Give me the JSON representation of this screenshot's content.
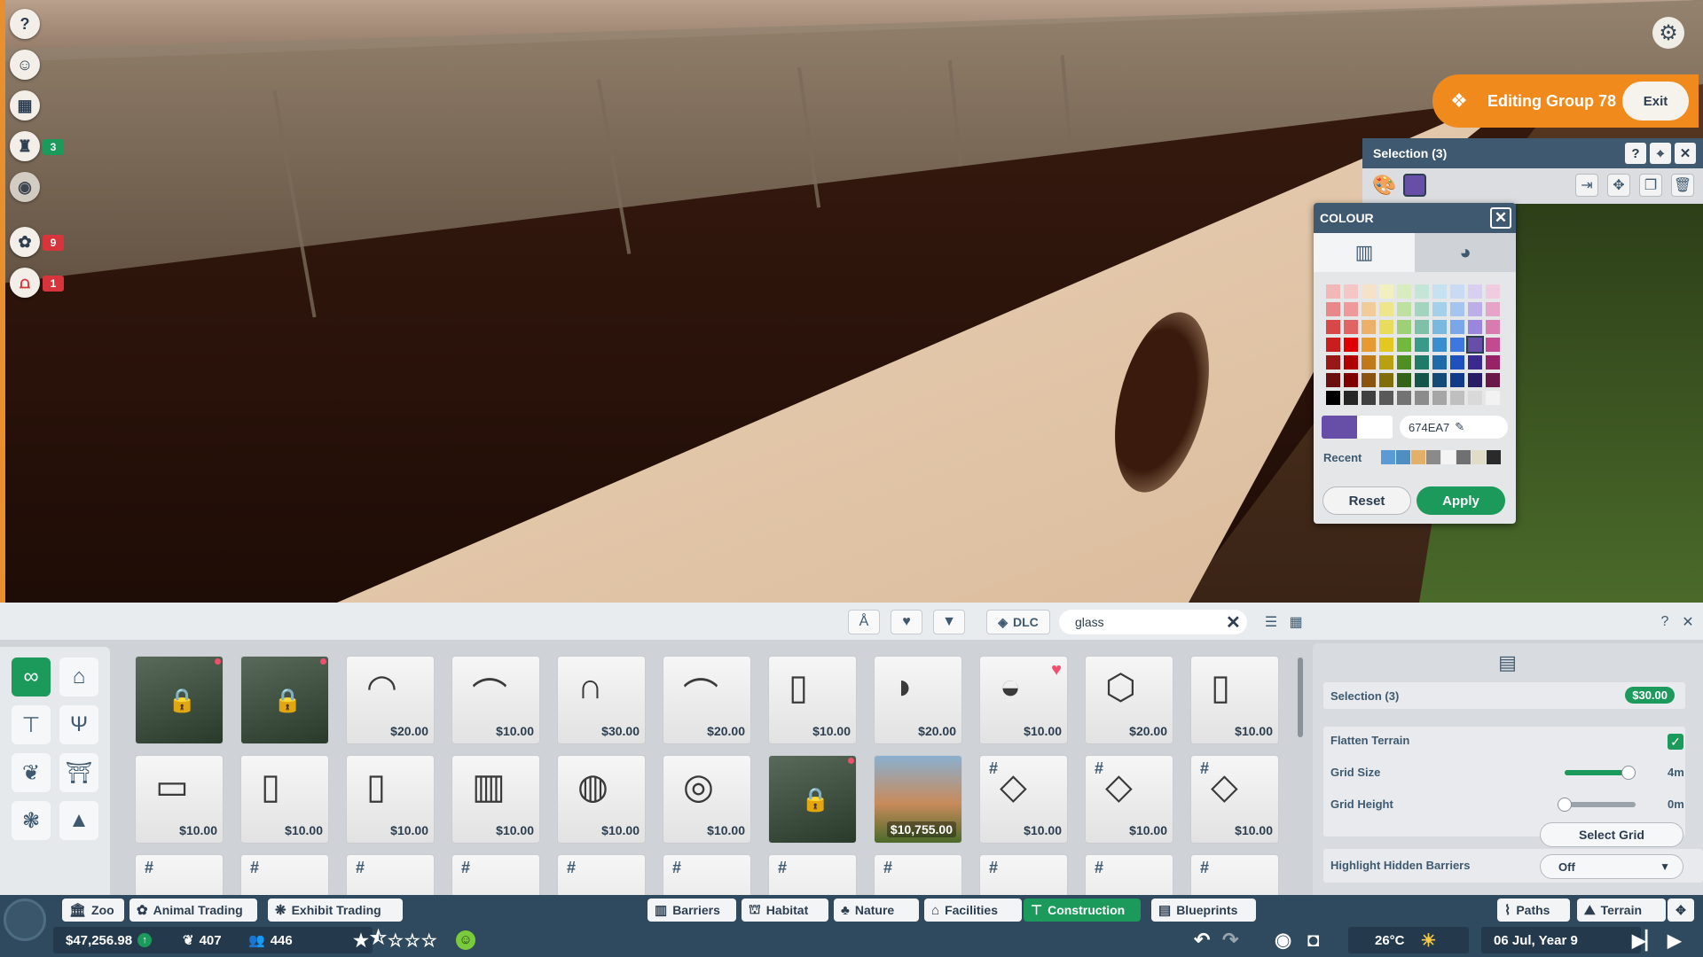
{
  "left_sidebar": {
    "items": [
      {
        "icon": "help-icon",
        "badge": ""
      },
      {
        "icon": "animal-face-icon",
        "badge": ""
      },
      {
        "icon": "calendar-icon",
        "badge": ""
      },
      {
        "icon": "trophy-icon",
        "badge": "3",
        "badge_color": "#1b9a5c"
      },
      {
        "icon": "eye-icon",
        "badge": ""
      },
      {
        "icon": "paw-icon",
        "badge": "9",
        "badge_color": "#d8343c"
      },
      {
        "icon": "habitat-gate-icon",
        "badge": "1",
        "badge_color": "#d8343c"
      }
    ]
  },
  "edit_mode": {
    "title": "Editing Group 78",
    "exit_label": "Exit"
  },
  "selection_panel": {
    "title": "Selection (3)"
  },
  "colour_panel": {
    "title": "COLOUR",
    "hex_value": "674EA7",
    "selected_color": "#674ea7",
    "recent_label": "Recent",
    "recent_colors": [
      "#5b9bd5",
      "#4f8ec0",
      "#e2b06a",
      "#8a8a8a",
      "#f4f4f4",
      "#707070",
      "#e0dcc8",
      "#2a2a2a"
    ],
    "reset_label": "Reset",
    "apply_label": "Apply",
    "palette": [
      [
        "#f2b8b8",
        "#f4c6c6",
        "#f6e2c8",
        "#f2efc0",
        "#d8ecc0",
        "#c4e6d8",
        "#c6e2f2",
        "#c8daf4",
        "#d8d0f0",
        "#f0cce0"
      ],
      [
        "#e88888",
        "#ee9a9a",
        "#f2cc98",
        "#eee68c",
        "#bee0a0",
        "#a2d4c0",
        "#a4d0ec",
        "#a6c4f0",
        "#bcaee8",
        "#e6a4c8"
      ],
      [
        "#d84848",
        "#e06464",
        "#ecb068",
        "#e8dc5c",
        "#9ed078",
        "#7ec0a8",
        "#7ab8e0",
        "#7aa6ea",
        "#9a86dc",
        "#d87cb0"
      ],
      [
        "#c81e1e",
        "#e00000",
        "#e69a30",
        "#e2c820",
        "#72b83c",
        "#3a9a8a",
        "#3a8ed0",
        "#3c78e0",
        "#674ea7",
        "#c24a90"
      ],
      [
        "#981818",
        "#b00000",
        "#c07818",
        "#b8a010",
        "#4e8e22",
        "#1f7a6a",
        "#1f6aa8",
        "#1e50c0",
        "#3a2a90",
        "#982266"
      ],
      [
        "#6a1010",
        "#7e0000",
        "#8a5410",
        "#806e0a",
        "#346216",
        "#14564a",
        "#144a78",
        "#123a8a",
        "#281c66",
        "#6a1848"
      ],
      [
        "#000000",
        "#262626",
        "#404040",
        "#595959",
        "#737373",
        "#8c8c8c",
        "#a6a6a6",
        "#bfbfbf",
        "#d9d9d9",
        "#f2f2f2"
      ]
    ]
  },
  "toolbar": {
    "dlc_label": "DLC",
    "search_value": "glass"
  },
  "items": [
    {
      "price": "",
      "thumb": "locked-scene",
      "locked": true
    },
    {
      "price": "",
      "thumb": "locked-scene",
      "locked": true
    },
    {
      "price": "$20.00",
      "glyph": "◠"
    },
    {
      "price": "$10.00",
      "glyph": "⌒"
    },
    {
      "price": "$30.00",
      "glyph": "∩"
    },
    {
      "price": "$20.00",
      "glyph": "⌒"
    },
    {
      "price": "$10.00",
      "glyph": "▯"
    },
    {
      "price": "$20.00",
      "glyph": "◗"
    },
    {
      "price": "$10.00",
      "glyph": "◒",
      "fav": true
    },
    {
      "price": "$20.00",
      "glyph": "⬡"
    },
    {
      "price": "$10.00",
      "glyph": "▯"
    },
    {
      "price": "$10.00",
      "glyph": "▭"
    },
    {
      "price": "$10.00",
      "glyph": "▯"
    },
    {
      "price": "$10.00",
      "glyph": "▯"
    },
    {
      "price": "$10.00",
      "glyph": "▥"
    },
    {
      "price": "$10.00",
      "glyph": "◍"
    },
    {
      "price": "$10.00",
      "glyph": "◎"
    },
    {
      "price": "",
      "thumb": "locked-scene",
      "locked": true
    },
    {
      "price": "$10,755.00",
      "thumb": "building"
    },
    {
      "price": "$10.00",
      "glyph": "◇",
      "hash": true
    },
    {
      "price": "$10.00",
      "glyph": "◇",
      "hash": true
    },
    {
      "price": "$10.00",
      "glyph": "◇",
      "hash": true
    }
  ],
  "info_panel": {
    "selection_label": "Selection (3)",
    "selection_price": "$30.00",
    "flatten_label": "Flatten Terrain",
    "grid_size_label": "Grid Size",
    "grid_size_value": "4m",
    "grid_size_level": 0.9,
    "grid_height_label": "Grid Height",
    "grid_height_value": "0m",
    "grid_height_level": 0.0,
    "select_grid_label": "Select Grid",
    "highlight_label": "Highlight Hidden Barriers",
    "highlight_value": "Off"
  },
  "nav": {
    "left_tabs": [
      "Zoo",
      "Animal Trading",
      "Exhibit Trading"
    ],
    "mid_tabs": [
      "Barriers",
      "Habitat",
      "Nature",
      "Facilities",
      "Construction",
      "Blueprints"
    ],
    "right_tabs": [
      "Paths",
      "Terrain"
    ],
    "active": "Construction"
  },
  "status": {
    "money": "$47,256.98",
    "conservation": "407",
    "guests": "446",
    "rating": 1.5,
    "temperature": "26°C",
    "date": "06 Jul, Year 9"
  }
}
